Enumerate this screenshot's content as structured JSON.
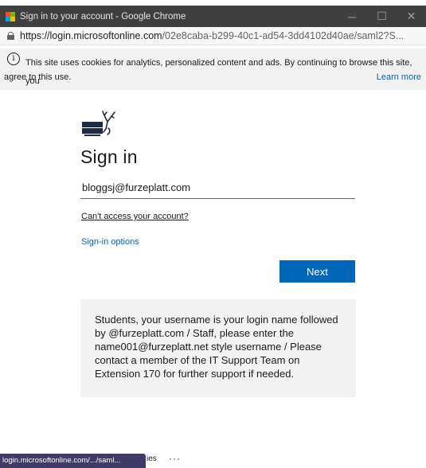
{
  "window": {
    "title": "Sign in to your account - Google Chrome",
    "controls": {
      "minimize": "─",
      "maximize": "☐",
      "close": "✕"
    }
  },
  "address_bar": {
    "host": "https://login.microsoftonline.com",
    "path": "/02e8caba-b299-40c1-ad54-3dd4102d40ae/saml2?S..."
  },
  "cookie_banner": {
    "text_line1": "This site uses cookies for analytics, personalized content and ads. By continuing to browse this site, you",
    "text_line2": "agree to this use.",
    "learn_more": "Learn more"
  },
  "signin": {
    "title": "Sign in",
    "email_value": "bloggsj@furzeplatt.com",
    "cant_access": "Can't access your account?",
    "signin_options": "Sign-in options",
    "next_label": "Next"
  },
  "notice": {
    "text": "Students, your username is your login name followed by @furzeplatt.com / Staff, please enter the name001@furzeplatt.net style username / Please contact a member of the IT Support Team on Extension 170 for further support if needed."
  },
  "footer": {
    "partial_text": "ies",
    "more": "···"
  },
  "status_bar": {
    "url": "login.microsoftonline.com/.../saml..."
  },
  "colors": {
    "accent": "#0067b8",
    "titlebar": "#404040",
    "ms_red": "#f25022",
    "ms_green": "#7fba00",
    "ms_blue": "#00a4ef",
    "ms_yellow": "#ffb900"
  }
}
